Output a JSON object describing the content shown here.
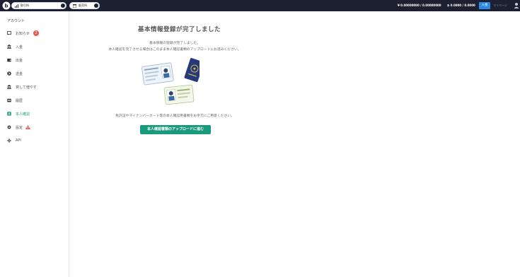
{
  "header": {
    "market_pill_1": "取引所",
    "market_pill_2": "販売所",
    "balance_jpy": "¥ 0.00000000 / 0.00000000",
    "balance_btc": "₿ 0.0000 / 0.0000",
    "deposit_button": "入金",
    "mypage_link": "マイページ"
  },
  "sidebar": {
    "title": "アカウント",
    "items": [
      {
        "label": "お知らせ",
        "badge": "2"
      },
      {
        "label": "入金"
      },
      {
        "label": "出金"
      },
      {
        "label": "送金"
      },
      {
        "label": "貸して増やす"
      },
      {
        "label": "履歴"
      },
      {
        "label": "本人確認"
      },
      {
        "label": "設定"
      },
      {
        "label": "API"
      }
    ]
  },
  "main": {
    "title": "基本情報登録が完了しました",
    "line1": "基本情報の登録が完了しました。",
    "line2": "本人確認を完了させる場合はこのまま本人確認書類のアップロードにお進みください。",
    "line3": "免許証やマイナンバーカード等の本人確認用書類をお手元にご用意ください。",
    "cta_button": "本人確認書類のアップロードに進む"
  },
  "colors": {
    "topbar_bg": "#1c2030",
    "accent_green": "#1a9a7c",
    "deposit_blue": "#2a89e6",
    "badge_red": "#e85a4f"
  }
}
